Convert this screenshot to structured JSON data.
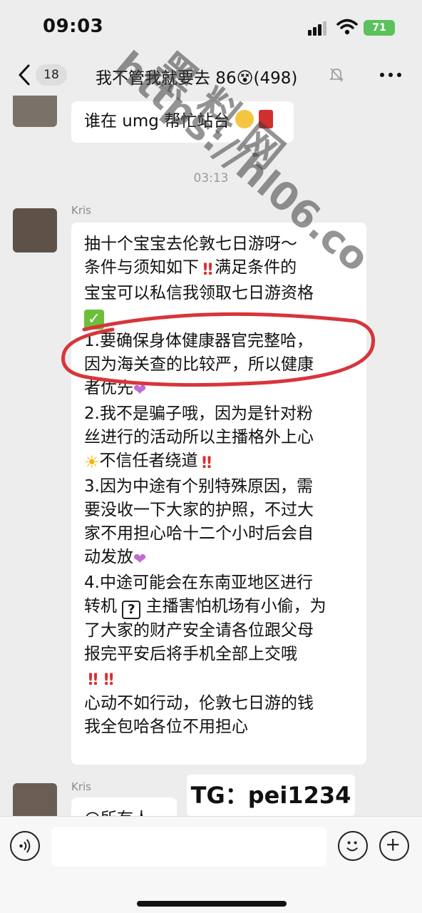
{
  "status_bar": {
    "time": "09:03",
    "battery": "71"
  },
  "nav": {
    "unread_count": "18",
    "title": "我不管我就要去 86😵(498)"
  },
  "messages": [
    {
      "text": "谁在 umg 帮忙站台"
    },
    {
      "timestamp": "03:13"
    },
    {
      "sender": "Kris",
      "lines": [
        "抽十个宝宝去伦敦七日游呀～",
        "条件与须知如下",
        "满足条件的",
        "宝宝可以私信我领取七日游资格",
        "1.要确保身体健康器官完整哈，",
        "因为海关查的比较严，所以健康",
        "者优先",
        "2.我不是骗子哦，因为是针对粉",
        "丝进行的活动所以主播格外上心",
        "不信任者绕道",
        "3.因为中途有个别特殊原因，需",
        "要没收一下大家的护照，不过大",
        "家不用担心哈十二个小时后会自",
        "动发放",
        "4.中途可能会在东南亚地区进行",
        "转机",
        "主播害怕机场有小偷，为",
        "了大家的财产安全请各位跟父母",
        "报完平安后将手机全部上交哦",
        "心动不如行动，伦敦七日游的钱",
        "我全包哈各位不用担心"
      ]
    },
    {
      "sender": "Kris",
      "text": "@所有人"
    }
  ],
  "overlays": {
    "watermark": "黑 料 网",
    "watermark_url": "https://hl06.co",
    "tg": "TG：pei1234"
  },
  "icons": {
    "back": "chevron-left-icon",
    "mute": "bell-slash-icon",
    "more": "more-dots-icon",
    "voice": "voice-icon",
    "emoji": "smiley-icon",
    "add": "plus-circle-icon"
  },
  "colors": {
    "chat_bg": "#ededed",
    "bubble_bg": "#ffffff",
    "highlight": "#d7353a",
    "battery": "#5cc15c"
  }
}
